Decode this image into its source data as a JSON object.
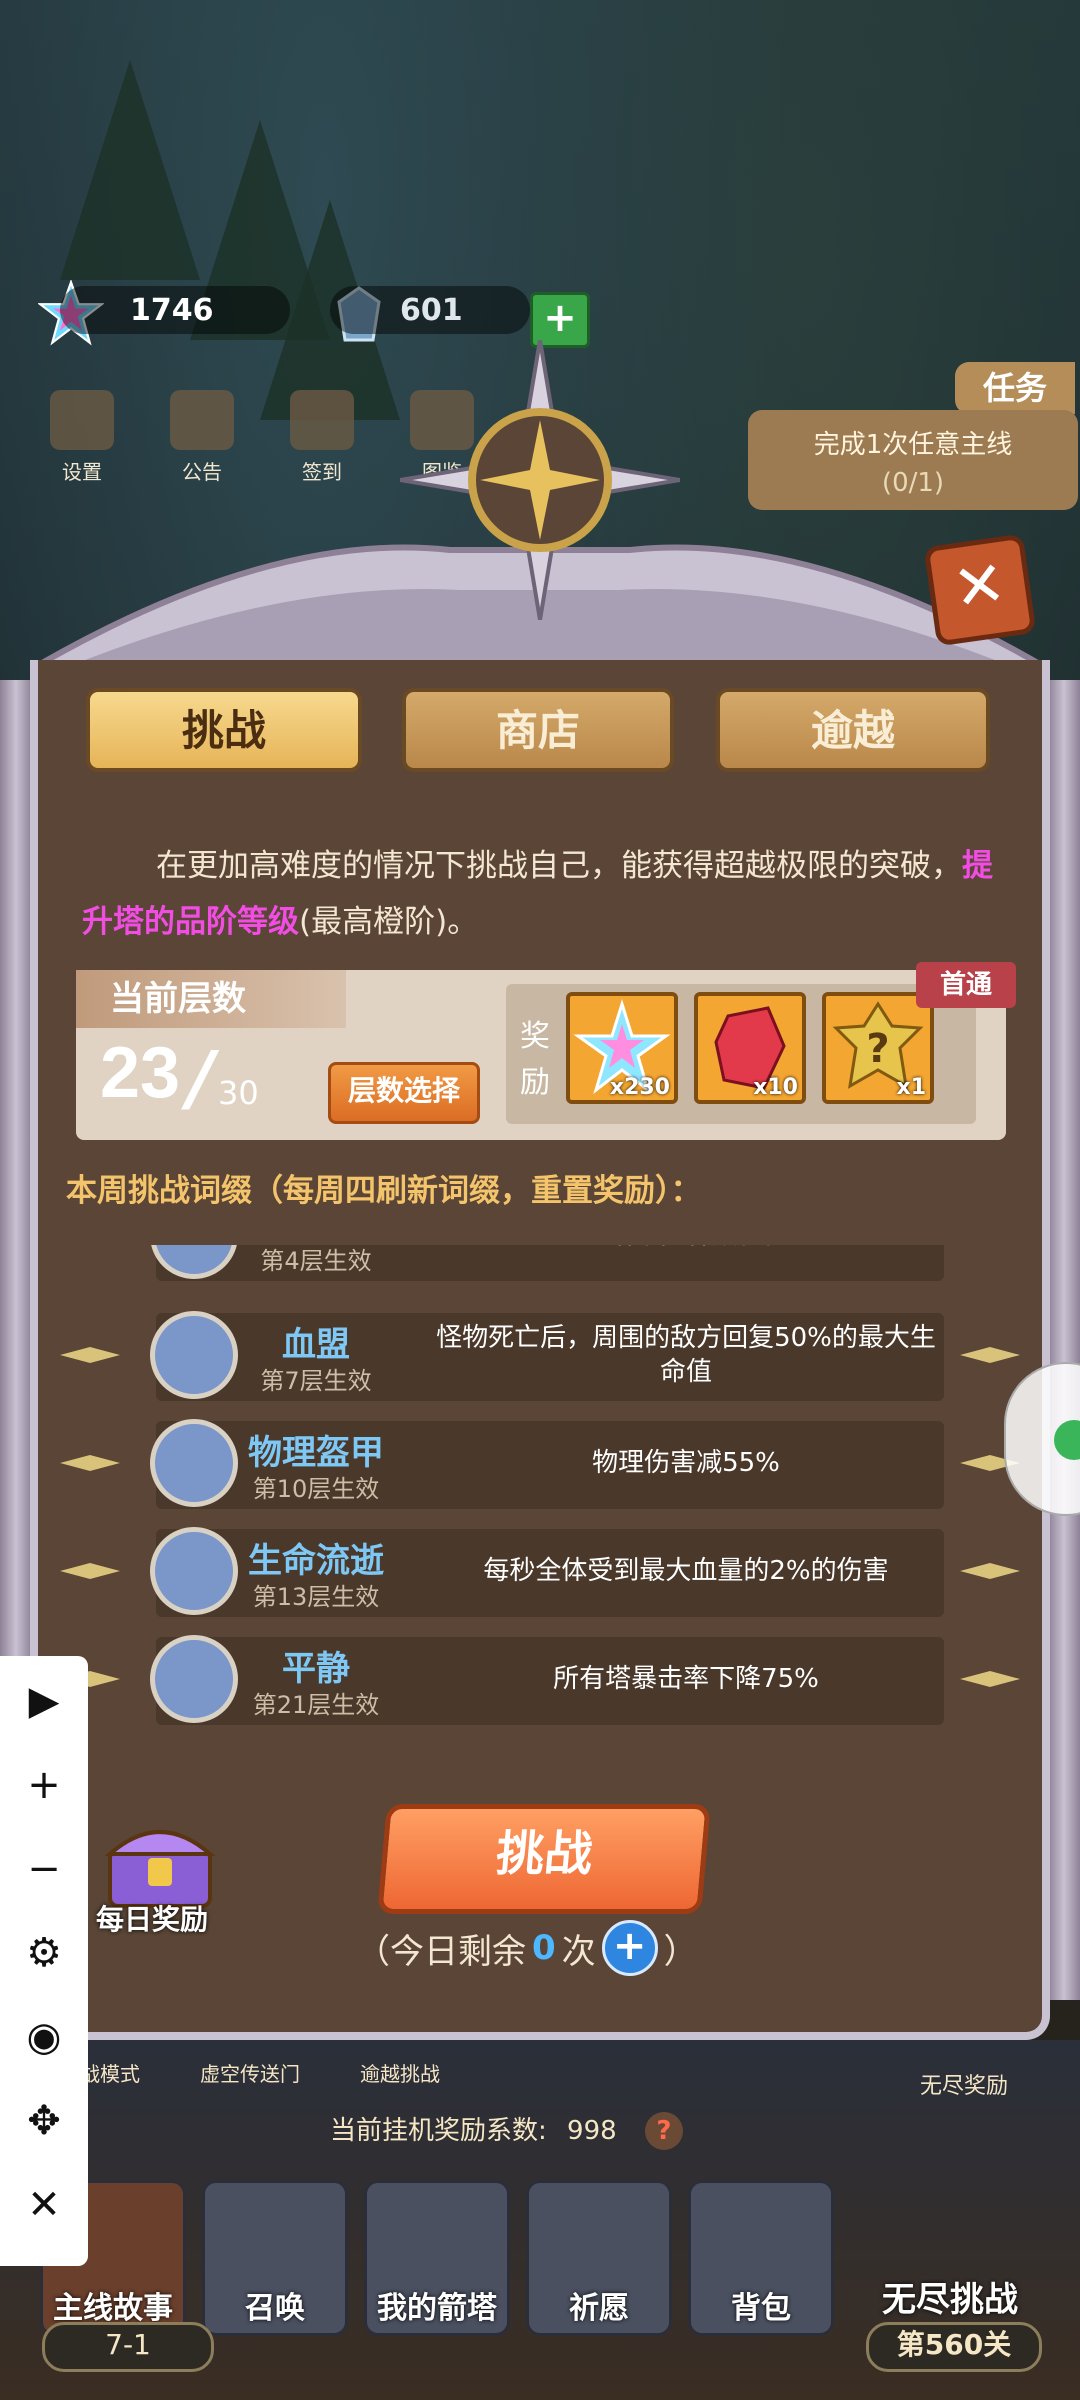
{
  "currency": {
    "stars": "1746",
    "gems": "601"
  },
  "top_menu": [
    {
      "label": "设置",
      "icon": "gear-icon"
    },
    {
      "label": "公告",
      "icon": "notice-icon"
    },
    {
      "label": "签到",
      "icon": "checkin-icon"
    },
    {
      "label": "图鉴",
      "icon": "book-icon"
    }
  ],
  "mission": {
    "tab_label": "任务",
    "text": "完成1次任意主线",
    "progress": "(0/1)"
  },
  "tabs": [
    {
      "label": "挑战",
      "active": true
    },
    {
      "label": "商店",
      "active": false
    },
    {
      "label": "逾越",
      "active": false
    }
  ],
  "intro": {
    "text_before": "在更加高难度的情况下挑战自己，能获得超越极限的突破，",
    "highlight": "提升塔的品阶等级",
    "text_after": "(最高橙阶)。"
  },
  "floor": {
    "label": "当前层数",
    "current": "23",
    "separator": "/",
    "max": "30",
    "select_button": "层数选择"
  },
  "reward": {
    "label": "奖励",
    "first_clear_badge": "首通",
    "items": [
      {
        "icon": "rainbow-star-icon",
        "count": "x230"
      },
      {
        "icon": "red-crystal-icon",
        "count": "x10"
      },
      {
        "icon": "mystery-item-icon",
        "count": "x1"
      }
    ]
  },
  "weekly_title": "本周挑战词缀（每周四刷新词缀，重置奖励）：",
  "affixes": [
    {
      "name": "",
      "floor": "第4层生效",
      "desc": "全塔不能释放普箭",
      "icon": "arrow-icon"
    },
    {
      "name": "血盟",
      "floor": "第7层生效",
      "desc": "怪物死亡后，周围的敌方回复50%的最大生命值",
      "icon": "blood-pact-icon"
    },
    {
      "name": "物理盔甲",
      "floor": "第10层生效",
      "desc": "物理伤害减55%",
      "icon": "shield-icon"
    },
    {
      "name": "生命流逝",
      "floor": "第13层生效",
      "desc": "每秒全体受到最大血量的2%的伤害",
      "icon": "broken-heart-icon"
    },
    {
      "name": "平静",
      "floor": "第21层生效",
      "desc": "所有塔暴击率下降75%",
      "icon": "swirl-icon"
    }
  ],
  "daily_reward": "每日奖励",
  "challenge_button": "挑战",
  "remaining": {
    "prefix": "（今日剩余",
    "count": "0",
    "suffix": "次",
    "close": "）"
  },
  "bottom": {
    "modes": [
      "挑战模式",
      "虚空传送门",
      "逾越挑战"
    ],
    "endless_reward": "无尽奖励",
    "coefficient_label": "当前挂机奖励系数:",
    "coefficient_value": "998",
    "nav": [
      "主线故事",
      "召唤",
      "我的箭塔",
      "祈愿",
      "背包",
      "无尽挑战"
    ],
    "stage": "7-1",
    "endless_stage": "第560关"
  },
  "colors": {
    "accent_orange": "#ee6733",
    "highlight_pink": "#f14de3",
    "affix_name_blue": "#7ec8f5",
    "weekly_gold": "#f3c46b"
  }
}
